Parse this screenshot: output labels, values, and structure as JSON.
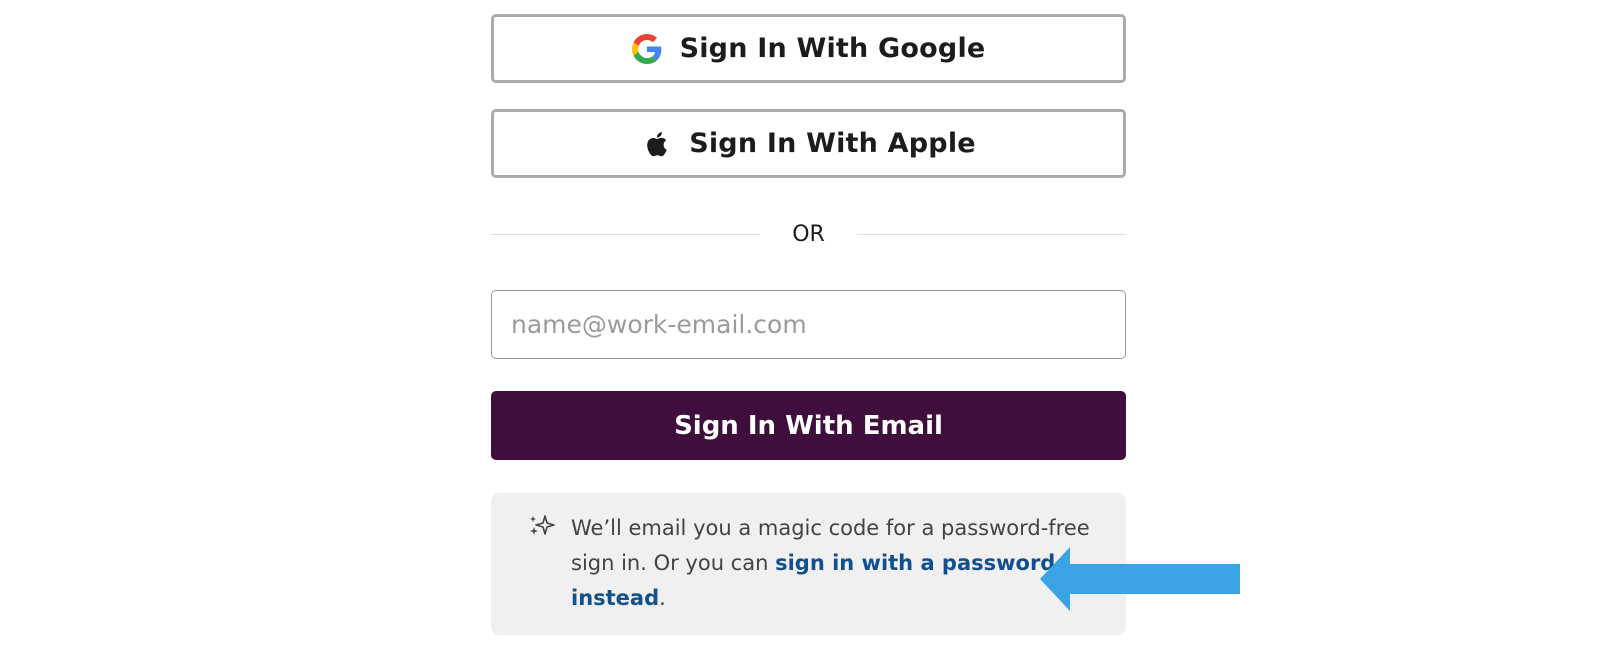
{
  "oauth": {
    "google_label": "Sign In With Google",
    "apple_label": "Sign In With Apple"
  },
  "divider": {
    "label": "OR"
  },
  "email": {
    "placeholder": "name@work-email.com",
    "value": ""
  },
  "email_button": {
    "label": "Sign In With Email"
  },
  "info": {
    "text_before": "We’ll email you a magic code for a password-free sign in. Or you can ",
    "link_label": "sign in with a password instead",
    "text_after": "."
  },
  "icons": {
    "google": "google-logo-icon",
    "apple": "apple-logo-icon",
    "sparkle": "sparkle-icon",
    "arrow": "arrow-left-annotation"
  },
  "colors": {
    "brand_purple": "#3f0e3d",
    "link_blue": "#124f8f",
    "annotation_arrow": "#3aa3e3",
    "google_blue": "#4285F4",
    "google_red": "#EA4335",
    "google_yellow": "#FBBC05",
    "google_green": "#34A853"
  }
}
